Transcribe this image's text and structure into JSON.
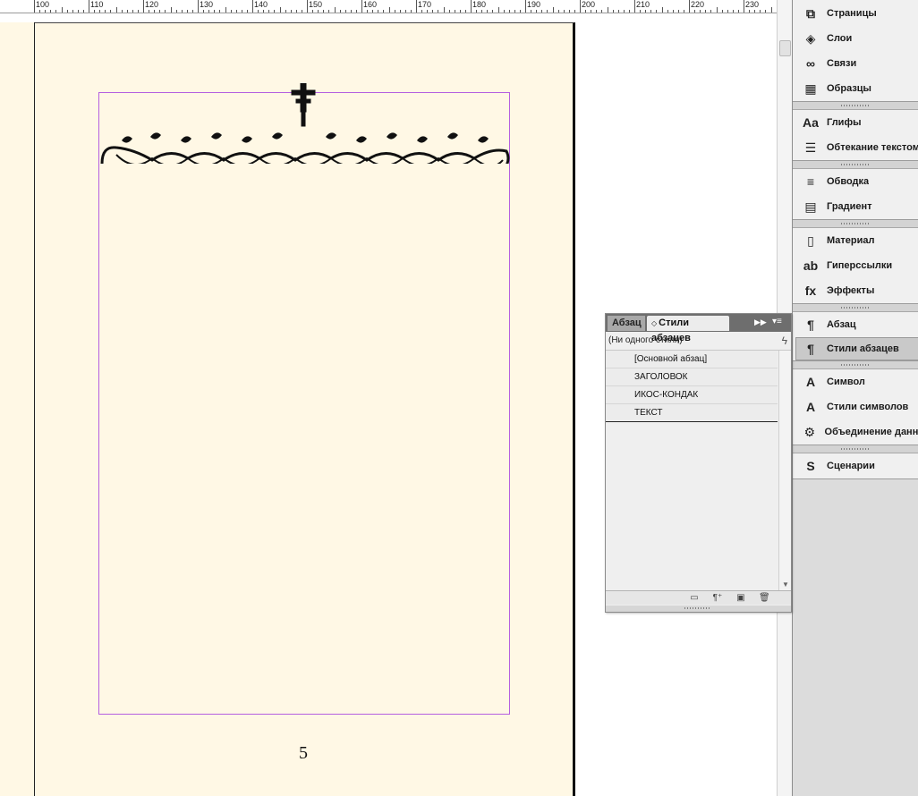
{
  "ruler": {
    "labels": [
      "100",
      "110",
      "120",
      "130",
      "140",
      "150",
      "160",
      "170",
      "180",
      "190",
      "200",
      "210",
      "220",
      "230"
    ]
  },
  "page": {
    "number": "5"
  },
  "dock": {
    "groups": [
      {
        "items": [
          {
            "label": "Страницы",
            "icon": "pages-icon"
          },
          {
            "label": "Слои",
            "icon": "layers-icon"
          },
          {
            "label": "Связи",
            "icon": "links-icon"
          },
          {
            "label": "Образцы",
            "icon": "swatches-icon"
          }
        ]
      },
      {
        "items": [
          {
            "label": "Глифы",
            "icon": "glyphs-icon"
          },
          {
            "label": "Обтекание текстом",
            "icon": "text-wrap-icon"
          }
        ]
      },
      {
        "items": [
          {
            "label": "Обводка",
            "icon": "stroke-icon"
          },
          {
            "label": "Градиент",
            "icon": "gradient-icon"
          }
        ]
      },
      {
        "items": [
          {
            "label": "Материал",
            "icon": "story-icon"
          },
          {
            "label": "Гиперссылки",
            "icon": "hyperlinks-icon"
          },
          {
            "label": "Эффекты",
            "icon": "effects-icon"
          }
        ]
      },
      {
        "items": [
          {
            "label": "Абзац",
            "icon": "paragraph-icon"
          },
          {
            "label": "Стили абзацев",
            "icon": "paragraph-styles-icon",
            "active": true
          }
        ]
      },
      {
        "items": [
          {
            "label": "Символ",
            "icon": "character-icon"
          },
          {
            "label": "Стили символов",
            "icon": "character-styles-icon"
          },
          {
            "label": "Объединение данных",
            "icon": "data-merge-icon"
          }
        ]
      },
      {
        "items": [
          {
            "label": "Сценарии",
            "icon": "scripts-icon"
          }
        ]
      }
    ]
  },
  "paragraph_styles_panel": {
    "tabs": {
      "paragraph": "Абзац",
      "paragraph_styles": "Стили абзацев"
    },
    "current_style": "(Ни одного стиля)",
    "styles": [
      "[Основной абзац]",
      "ЗАГОЛОВОК",
      "ИКОС-КОНДАК",
      "ТЕКСТ"
    ]
  }
}
